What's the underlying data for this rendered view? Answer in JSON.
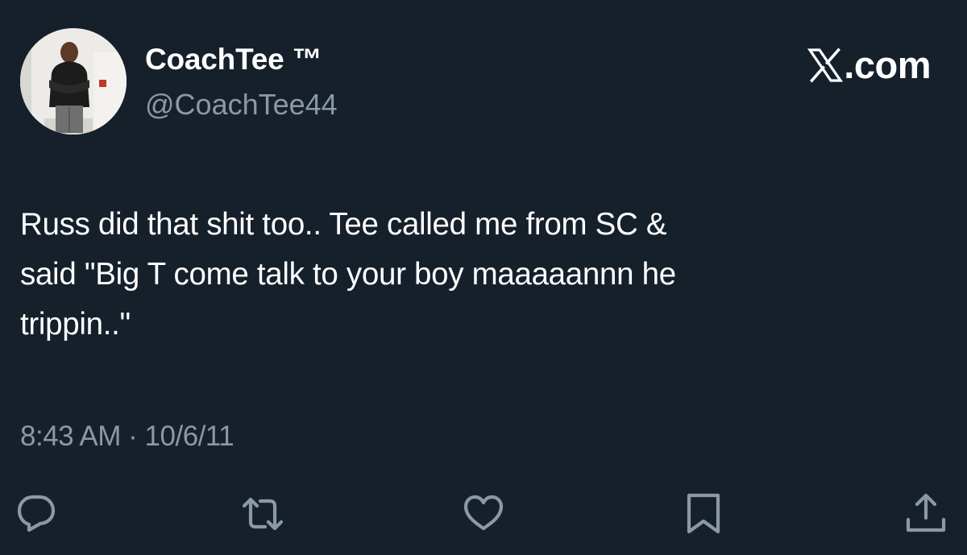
{
  "author": {
    "display_name": "CoachTee ™",
    "handle": "@CoachTee44",
    "avatar_icon": "profile-photo"
  },
  "brand": {
    "logo_icon": "x-logo-icon",
    "text": ".com"
  },
  "tweet": {
    "text": "Russ did that shit too.. Tee called me from SC &\nsaid \"Big T come talk to your boy maaaaannn he\ntrippin..\"",
    "time": "8:43 AM",
    "separator": "·",
    "date": "10/6/11"
  },
  "actions": [
    {
      "name": "reply",
      "icon": "reply-icon"
    },
    {
      "name": "retweet",
      "icon": "retweet-icon"
    },
    {
      "name": "like",
      "icon": "heart-icon"
    },
    {
      "name": "bookmark",
      "icon": "bookmark-icon"
    },
    {
      "name": "share",
      "icon": "share-icon"
    }
  ],
  "colors": {
    "background": "#16202b",
    "primary_text": "#ffffff",
    "secondary_text": "#8b98a5"
  }
}
